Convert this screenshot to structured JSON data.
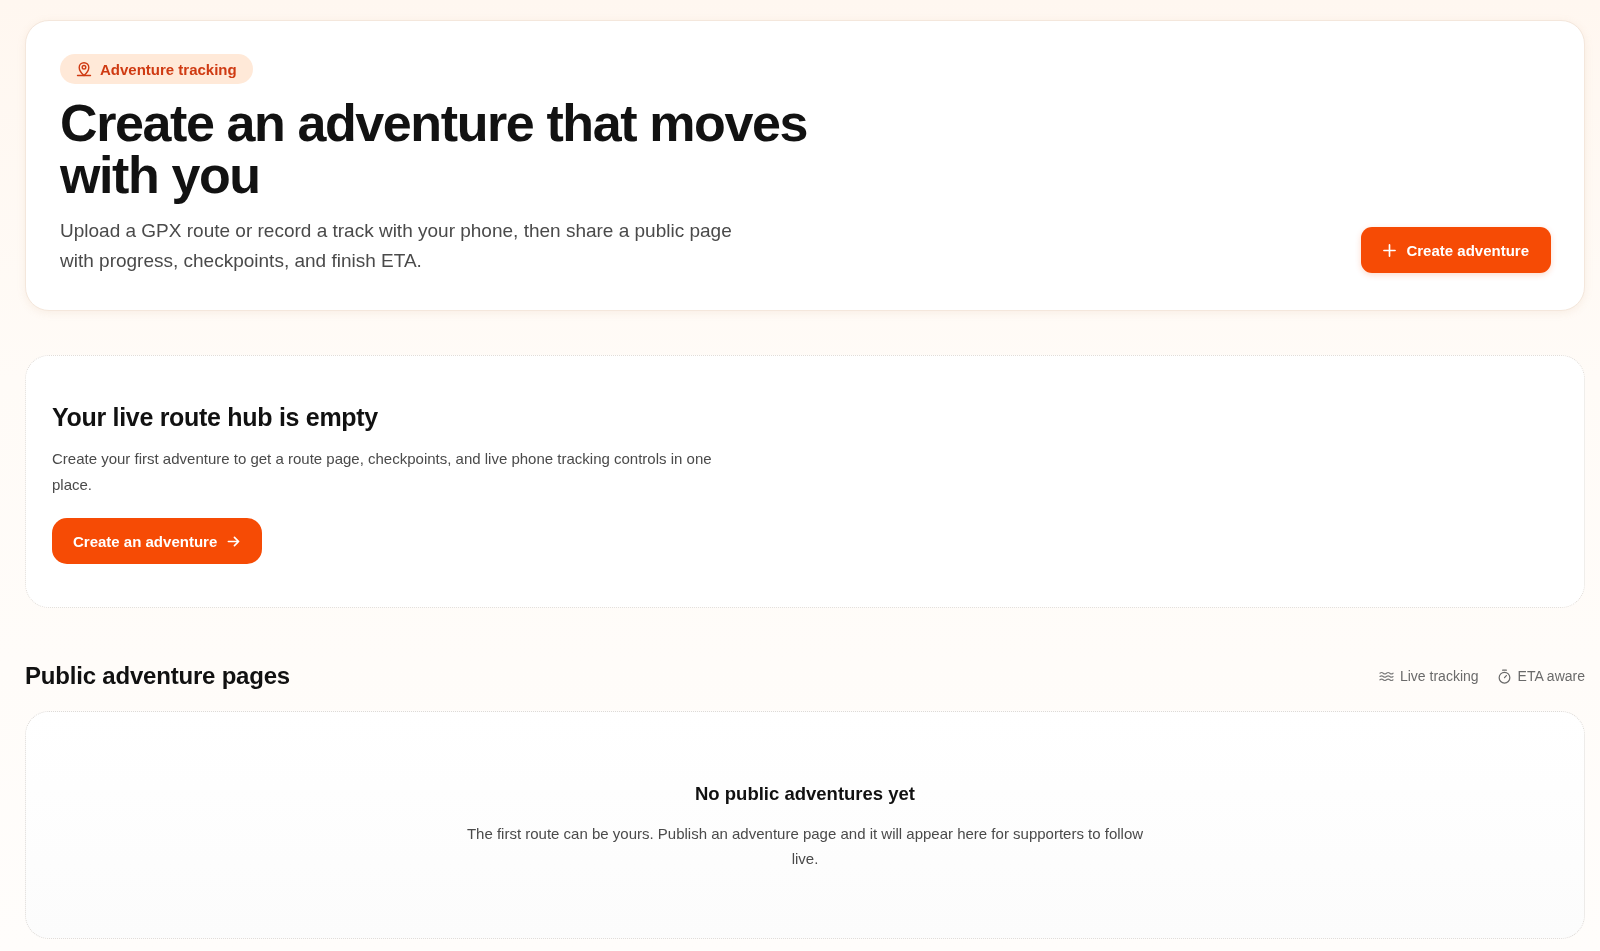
{
  "hero": {
    "badge": "Adventure tracking",
    "title": "Create an adventure that moves with you",
    "description": "Upload a GPX route or record a track with your phone, then share a public page with progress, checkpoints, and finish ETA.",
    "button": "Create adventure"
  },
  "empty_hub": {
    "title": "Your live route hub is empty",
    "description": "Create your first adventure to get a route page, checkpoints, and live phone tracking controls in one place.",
    "button": "Create an adventure"
  },
  "public_pages": {
    "title": "Public adventure pages",
    "features": [
      {
        "kind": "waves",
        "label": "Live tracking"
      },
      {
        "kind": "stopwatch",
        "label": "ETA aware"
      }
    ],
    "empty_state": {
      "title": "No public adventures yet",
      "description": "The first route can be yours. Publish an adventure page and it will appear here for supporters to follow live."
    }
  }
}
